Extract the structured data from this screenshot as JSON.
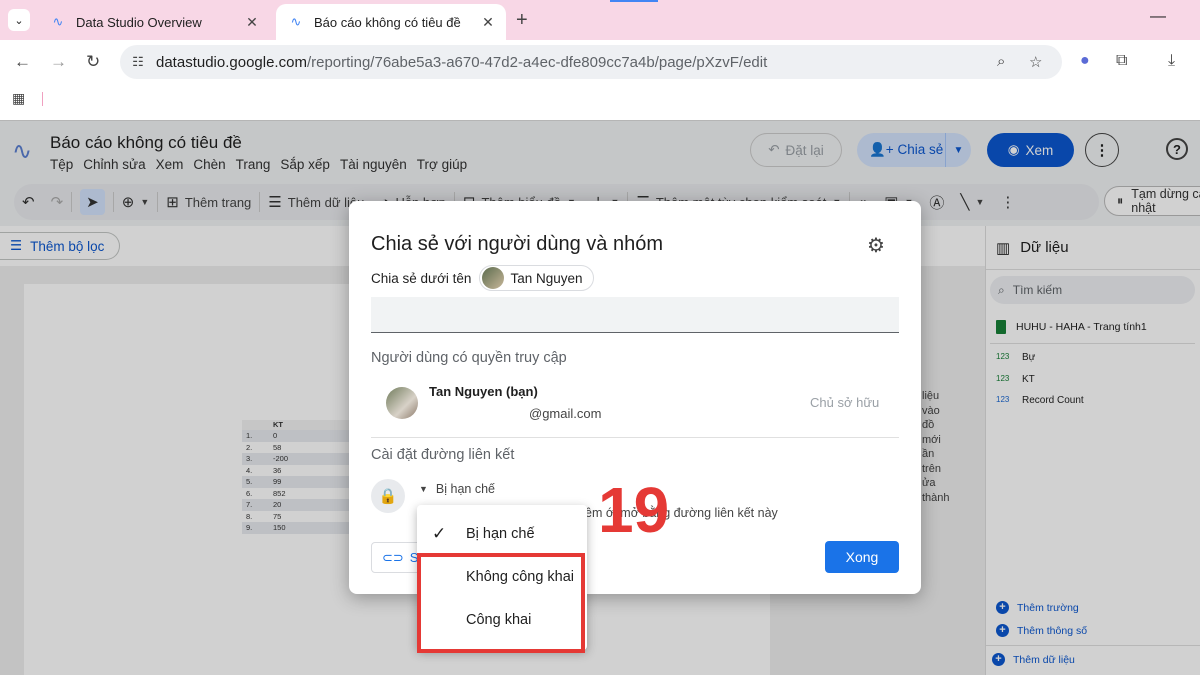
{
  "browser": {
    "tabs": [
      {
        "title": "Data Studio Overview"
      },
      {
        "title": "Báo cáo không có tiêu đề"
      }
    ],
    "url_host": "datastudio.google.com",
    "url_path": "/reporting/76abe5a3-a670-47d2-a4ec-dfe809cc7a4b/page/pXzvF/edit"
  },
  "app": {
    "title": "Báo cáo không có tiêu đề",
    "menus": [
      "Tệp",
      "Chỉnh sửa",
      "Xem",
      "Chèn",
      "Trang",
      "Sắp xếp",
      "Tài nguyên",
      "Trợ giúp"
    ],
    "reset_label": "Đặt lại",
    "share_label": "Chia sẻ",
    "view_label": "Xem"
  },
  "toolbar": {
    "add_page": "Thêm trang",
    "add_data": "Thêm dữ liệu",
    "blend": "Hỗn hợp",
    "add_chart": "Thêm biểu đồ",
    "add_control": "Thêm một tùy chọn kiểm soát",
    "pause": "Tạm dừng cập nhật"
  },
  "filter_label": "Thêm bộ lọc",
  "canvas": {
    "table_header": "KT",
    "rows": [
      {
        "n": "1.",
        "v": "0"
      },
      {
        "n": "2.",
        "v": "58"
      },
      {
        "n": "3.",
        "v": "-200"
      },
      {
        "n": "4.",
        "v": "36"
      },
      {
        "n": "5.",
        "v": "99"
      },
      {
        "n": "6.",
        "v": "852"
      },
      {
        "n": "7.",
        "v": "20"
      },
      {
        "n": "8.",
        "v": "75"
      },
      {
        "n": "9.",
        "v": "150"
      }
    ],
    "hint_lines": [
      "liệu vào",
      "đồ mới",
      "ần trên",
      "ửa thành"
    ]
  },
  "data_panel": {
    "title": "Dữ liệu",
    "search_placeholder": "Tìm kiếm",
    "source": "HUHU - HAHA - Trang tính1",
    "fields": [
      {
        "type": "123",
        "name": "Bự"
      },
      {
        "type": "123",
        "name": "KT"
      },
      {
        "type": "123",
        "name": "Record Count"
      }
    ],
    "add_field": "Thêm trường",
    "add_param": "Thêm thông số",
    "add_data": "Thêm dữ liệu"
  },
  "dialog": {
    "title": "Chia sẻ với người dùng và nhóm",
    "share_as_label": "Chia sẻ dưới tên",
    "share_as_name": "Tan Nguyen",
    "access_section": "Người dùng có quyền truy cập",
    "user_name": "Tan Nguyen (bạn)",
    "user_email": "@gmail.com",
    "user_role": "Chủ sở hữu",
    "link_section": "Cài đặt đường liên kết",
    "link_mode": "Bị hạn chế",
    "link_desc": "êm        ới        mở bằng đường liên kết này",
    "copy_label": "Sa",
    "done_label": "Xong"
  },
  "dropdown": {
    "options": [
      {
        "label": "Bị hạn chế",
        "checked": true
      },
      {
        "label": "Không công khai",
        "checked": false
      },
      {
        "label": "Công khai",
        "checked": false
      }
    ]
  },
  "step_number": "19",
  "colors": {
    "accent": "#0b57d0",
    "highlight": "#e53935"
  }
}
